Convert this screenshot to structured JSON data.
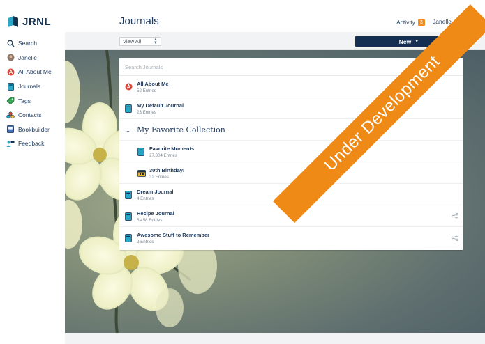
{
  "app": {
    "logo_text": "JRNL"
  },
  "sidebar": {
    "items": [
      {
        "label": "Search",
        "icon": "search-icon"
      },
      {
        "label": "Janelle",
        "icon": "avatar-icon"
      },
      {
        "label": "All About Me",
        "icon": "all-about-me-icon"
      },
      {
        "label": "Journals",
        "icon": "journal-icon"
      },
      {
        "label": "Tags",
        "icon": "tag-icon"
      },
      {
        "label": "Contacts",
        "icon": "contacts-icon"
      },
      {
        "label": "Bookbuilder",
        "icon": "book-icon"
      },
      {
        "label": "Feedback",
        "icon": "feedback-icon"
      }
    ]
  },
  "header": {
    "title": "Journals",
    "activity_label": "Activity",
    "activity_count": "3",
    "user_name": "Janelle"
  },
  "toolbar": {
    "filter_value": "View All",
    "new_label": "New"
  },
  "journals": {
    "search_placeholder": "Search Journals",
    "items": [
      {
        "title": "All About Me",
        "entries": "52 Entries",
        "icon": "all-about-me-icon"
      },
      {
        "title": "My Default Journal",
        "entries": "23 Entries",
        "icon": "journal-icon"
      }
    ],
    "collection": {
      "title": "My Favorite Collection",
      "items": [
        {
          "title": "Favorite Moments",
          "entries": "27,304 Entries",
          "icon": "journal-icon"
        },
        {
          "title": "30th Birthday!",
          "entries": "32 Entries",
          "icon": "calendar-journal-icon"
        }
      ]
    },
    "more_items": [
      {
        "title": "Dream Journal",
        "entries": "4 Entries",
        "icon": "journal-icon"
      },
      {
        "title": "Recipe Journal",
        "entries": "5,458 Entries",
        "icon": "journal-icon"
      },
      {
        "title": "Awesome Stuff to Remember",
        "entries": "2 Entries",
        "icon": "journal-icon"
      }
    ]
  },
  "banner": {
    "text": "Under Development"
  },
  "colors": {
    "navy": "#142f52",
    "orange": "#ee8a15",
    "teal": "#2aa6c7"
  }
}
